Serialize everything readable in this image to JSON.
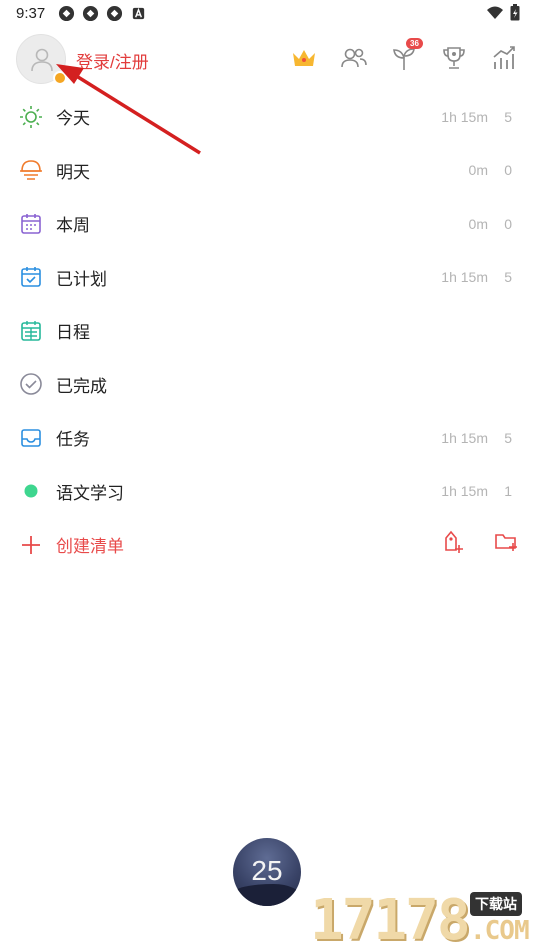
{
  "status_bar": {
    "time": "9:37",
    "icons": [
      "app-notification-icon",
      "app-notification-icon",
      "app-notification-icon",
      "a-icon"
    ],
    "right_icons": [
      "wifi-icon",
      "battery-icon"
    ]
  },
  "header": {
    "login_label": "登录/注册",
    "icons": [
      "crown-icon",
      "friends-icon",
      "sprout-icon",
      "trophy-icon",
      "stats-icon"
    ],
    "sprout_badge": "36"
  },
  "lists": [
    {
      "icon": "sun-icon",
      "color": "#4caf50",
      "label": "今天",
      "time": "1h 15m",
      "count": "5"
    },
    {
      "icon": "sunset-icon",
      "color": "#f07a2a",
      "label": "明天",
      "time": "0m",
      "count": "0"
    },
    {
      "icon": "calendar-week-icon",
      "color": "#8a63d2",
      "label": "本周",
      "time": "0m",
      "count": "0"
    },
    {
      "icon": "calendar-check-icon",
      "color": "#2b8fe0",
      "label": "已计划",
      "time": "1h 15m",
      "count": "5"
    },
    {
      "icon": "calendar-grid-icon",
      "color": "#26b89a",
      "label": "日程",
      "time": "",
      "count": ""
    },
    {
      "icon": "check-circle-icon",
      "color": "#8a8a99",
      "label": "已完成",
      "time": "",
      "count": ""
    },
    {
      "icon": "inbox-icon",
      "color": "#2b8fe0",
      "label": "任务",
      "time": "1h 15m",
      "count": "5"
    },
    {
      "icon": "green-dot-icon",
      "color": "#3ed68f",
      "label": "语文学习",
      "time": "1h 15m",
      "count": "1"
    }
  ],
  "create_list": {
    "label": "创建清单",
    "icons": [
      "add-tag-icon",
      "add-folder-icon"
    ]
  },
  "timer": {
    "value": "25"
  },
  "watermark": {
    "number": "17178",
    "box": "下载站",
    "suffix": ".COM"
  },
  "colors": {
    "accent": "#e84a4a",
    "muted": "#b4b4b4"
  }
}
